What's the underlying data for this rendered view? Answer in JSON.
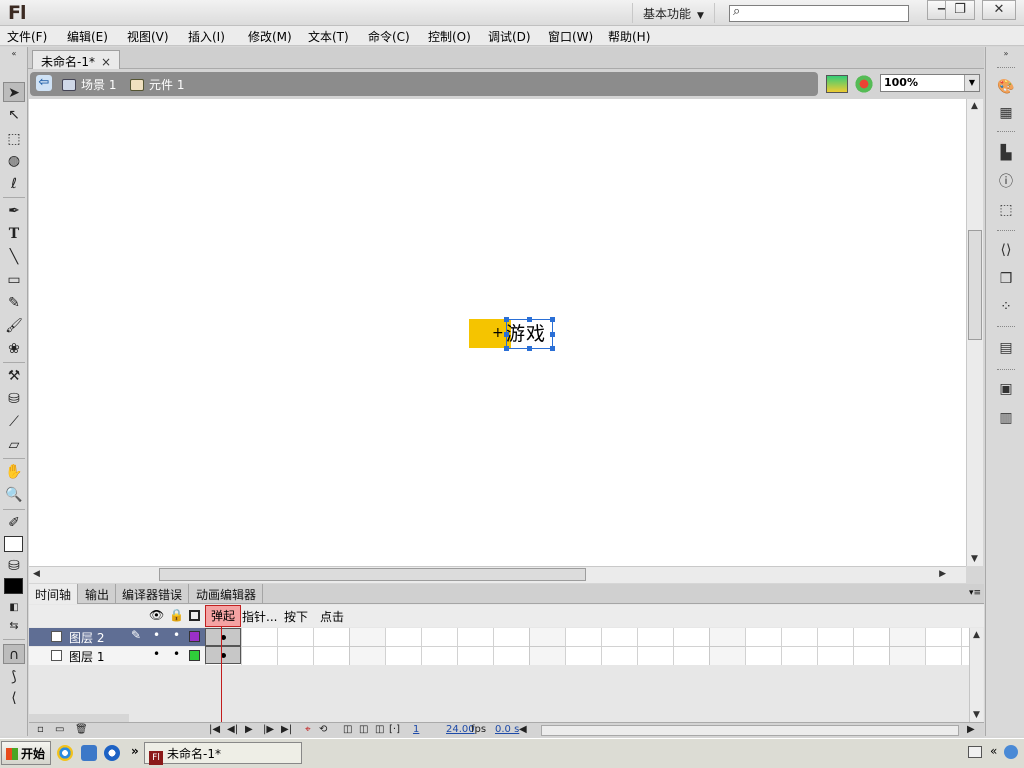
{
  "app": {
    "logo": "Fl",
    "workspace": "基本功能",
    "search_placeholder": ""
  },
  "window_controls": {
    "minimize": "−",
    "restore": "❐",
    "close": "✕"
  },
  "menu": [
    "文件(F)",
    "编辑(E)",
    "视图(V)",
    "插入(I)",
    "修改(M)",
    "文本(T)",
    "命令(C)",
    "控制(O)",
    "调试(D)",
    "窗口(W)",
    "帮助(H)"
  ],
  "document_tab": {
    "title": "未命名-1*",
    "close": "×"
  },
  "breadcrumb": {
    "scene": "场景 1",
    "symbol": "元件 1"
  },
  "zoom": "100%",
  "stage": {
    "button_text": "游戏",
    "button_color": "#f5c400"
  },
  "timeline": {
    "tabs": [
      "时间轴",
      "输出",
      "编译器错误",
      "动画编辑器"
    ],
    "frame_labels": [
      "弹起",
      "指针...",
      "按下",
      "点击"
    ],
    "layers": [
      {
        "name": "图层 2",
        "selected": true,
        "color": "#9b30c8"
      },
      {
        "name": "图层 1",
        "selected": false,
        "color": "#2fcf3a"
      }
    ],
    "footer": {
      "frame": "1",
      "fps": "24.00",
      "fps_unit": "fps",
      "time": "0.0 s"
    }
  },
  "taskbar": {
    "start": "开始",
    "window_title": "未命名-1*",
    "more": "»"
  }
}
